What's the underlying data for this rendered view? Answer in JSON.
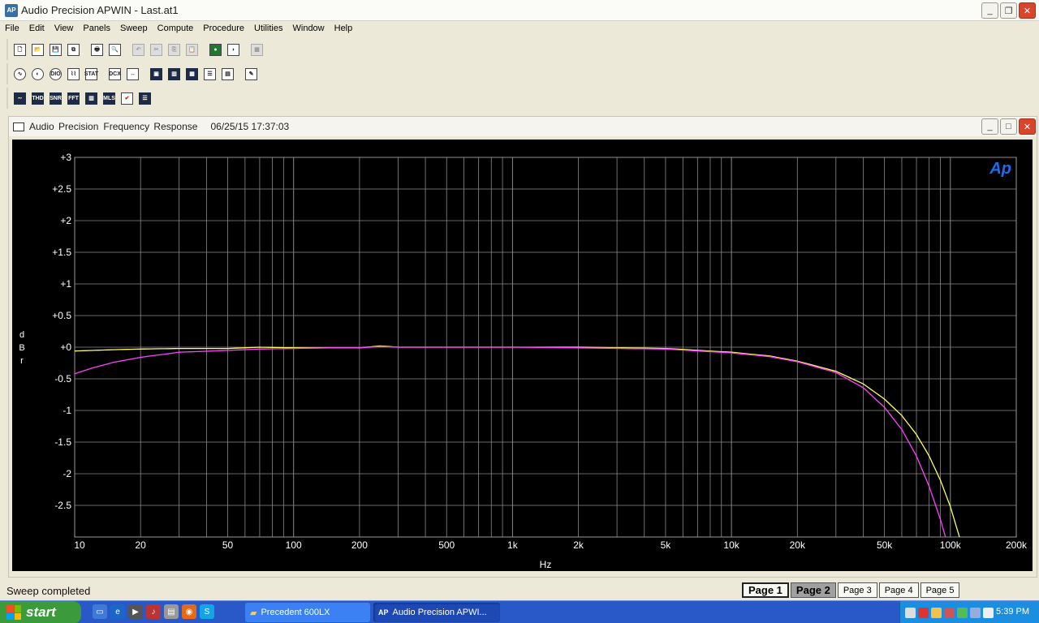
{
  "window": {
    "title": "Audio Precision APWIN - Last.at1",
    "icon": "ap-app-icon"
  },
  "menu": [
    "File",
    "Edit",
    "View",
    "Panels",
    "Sweep",
    "Compute",
    "Procedure",
    "Utilities",
    "Window",
    "Help"
  ],
  "toolbar1": [
    {
      "name": "new-file-icon",
      "glyph": "🗋"
    },
    {
      "name": "open-folder-icon",
      "glyph": "📂"
    },
    {
      "name": "save-icon",
      "glyph": "💾"
    },
    {
      "name": "save-all-icon",
      "glyph": "⧉"
    },
    {
      "name": "print-icon",
      "glyph": "🖶"
    },
    {
      "name": "print-preview-icon",
      "glyph": "🔍"
    },
    {
      "name": "undo-icon",
      "glyph": "↶"
    },
    {
      "name": "cut-icon",
      "glyph": "✂"
    },
    {
      "name": "copy-icon",
      "glyph": "⎘"
    },
    {
      "name": "paste-icon",
      "glyph": "📋"
    },
    {
      "name": "go-sweep-icon",
      "glyph": "●"
    },
    {
      "name": "stop-icon",
      "glyph": "◗"
    },
    {
      "name": "graph-settings-icon",
      "glyph": "▦"
    }
  ],
  "toolbar2": [
    {
      "name": "analog-generator-icon",
      "label": "∿"
    },
    {
      "name": "analog-analyzer-icon",
      "label": "◐"
    },
    {
      "name": "digital-io-icon",
      "label": "DIO"
    },
    {
      "name": "sweep-settings-icon",
      "label": "⌇⌇"
    },
    {
      "name": "stat-bit-icon",
      "label": "STAT"
    },
    {
      "name": "dcx-icon",
      "label": "DCX"
    },
    {
      "name": "switcher-icon",
      "label": "↔"
    },
    {
      "name": "compute-icon",
      "label": "▣"
    },
    {
      "name": "bar-graph-icon",
      "label": "▥"
    },
    {
      "name": "graph-panel-icon",
      "label": "▦"
    },
    {
      "name": "data-editor-icon",
      "label": "☰"
    },
    {
      "name": "list-icon",
      "label": "▤"
    },
    {
      "name": "attach-icon",
      "label": "✎"
    }
  ],
  "toolbar3": [
    {
      "name": "freq-response-icon",
      "label": "∼"
    },
    {
      "name": "thd-icon",
      "label": "THD"
    },
    {
      "name": "snr-icon",
      "label": "SNR"
    },
    {
      "name": "fft-icon",
      "label": "FFT"
    },
    {
      "name": "spectrum-icon",
      "label": "▥"
    },
    {
      "name": "mls-icon",
      "label": "MLS"
    },
    {
      "name": "check-icon",
      "label": "✔"
    },
    {
      "name": "report-icon",
      "label": "☰"
    }
  ],
  "graph": {
    "title_prefix": "Audio Precision",
    "title": "Frequency Response",
    "timestamp": "06/25/15 17:37:03",
    "logo": "Ap"
  },
  "chart_data": {
    "type": "line",
    "xscale": "log",
    "xlim": [
      10,
      200000
    ],
    "ylim": [
      -3,
      3
    ],
    "xlabel": "Hz",
    "ylabel": "dBr",
    "grid": true,
    "xticks": [
      10,
      20,
      50,
      100,
      200,
      500,
      1000,
      2000,
      5000,
      10000,
      20000,
      50000,
      100000,
      200000
    ],
    "xtick_labels": [
      "10",
      "20",
      "50",
      "100",
      "200",
      "500",
      "1k",
      "2k",
      "5k",
      "10k",
      "20k",
      "50k",
      "100k",
      "200k"
    ],
    "yticks": [
      3,
      2.5,
      2,
      1.5,
      1,
      0.5,
      0,
      -0.5,
      -1,
      -1.5,
      -2,
      -2.5
    ],
    "ytick_labels": [
      "+3",
      "+2.5",
      "+2",
      "+1.5",
      "+1",
      "+0.5",
      "+0",
      "-0.5",
      "-1",
      "-1.5",
      "-2",
      "-2.5"
    ],
    "series": [
      {
        "color": "#ffff60",
        "x": [
          10,
          15,
          20,
          30,
          50,
          70,
          100,
          150,
          200,
          250,
          300,
          500,
          1000,
          2000,
          5000,
          10000,
          15000,
          20000,
          30000,
          40000,
          50000,
          60000,
          70000,
          80000,
          90000,
          100000,
          110000
        ],
        "y": [
          -0.06,
          -0.04,
          -0.03,
          -0.02,
          -0.02,
          0.0,
          -0.01,
          -0.01,
          -0.01,
          0.02,
          0.0,
          -0.0,
          -0.0,
          -0.0,
          -0.02,
          -0.08,
          -0.14,
          -0.22,
          -0.38,
          -0.58,
          -0.82,
          -1.08,
          -1.38,
          -1.72,
          -2.1,
          -2.52,
          -3.0
        ]
      },
      {
        "color": "#ff40ff",
        "x": [
          10,
          12,
          15,
          20,
          30,
          50,
          70,
          100,
          150,
          200,
          250,
          300,
          500,
          1000,
          2000,
          5000,
          10000,
          15000,
          20000,
          30000,
          40000,
          50000,
          60000,
          70000,
          80000,
          90000,
          95000
        ],
        "y": [
          -0.42,
          -0.33,
          -0.24,
          -0.16,
          -0.08,
          -0.05,
          -0.03,
          -0.02,
          -0.01,
          -0.01,
          0.01,
          0.0,
          0.0,
          0.0,
          -0.01,
          -0.03,
          -0.09,
          -0.15,
          -0.23,
          -0.4,
          -0.64,
          -0.95,
          -1.3,
          -1.72,
          -2.2,
          -2.72,
          -3.0
        ]
      }
    ]
  },
  "status": "Sweep completed",
  "pages": [
    "Page 1",
    "Page 2",
    "Page 3",
    "Page 4",
    "Page 5"
  ],
  "taskbar": {
    "start": "start",
    "tasks": [
      "Precedent 600LX",
      "Audio Precision APWI..."
    ],
    "clock": "5:39 PM"
  }
}
